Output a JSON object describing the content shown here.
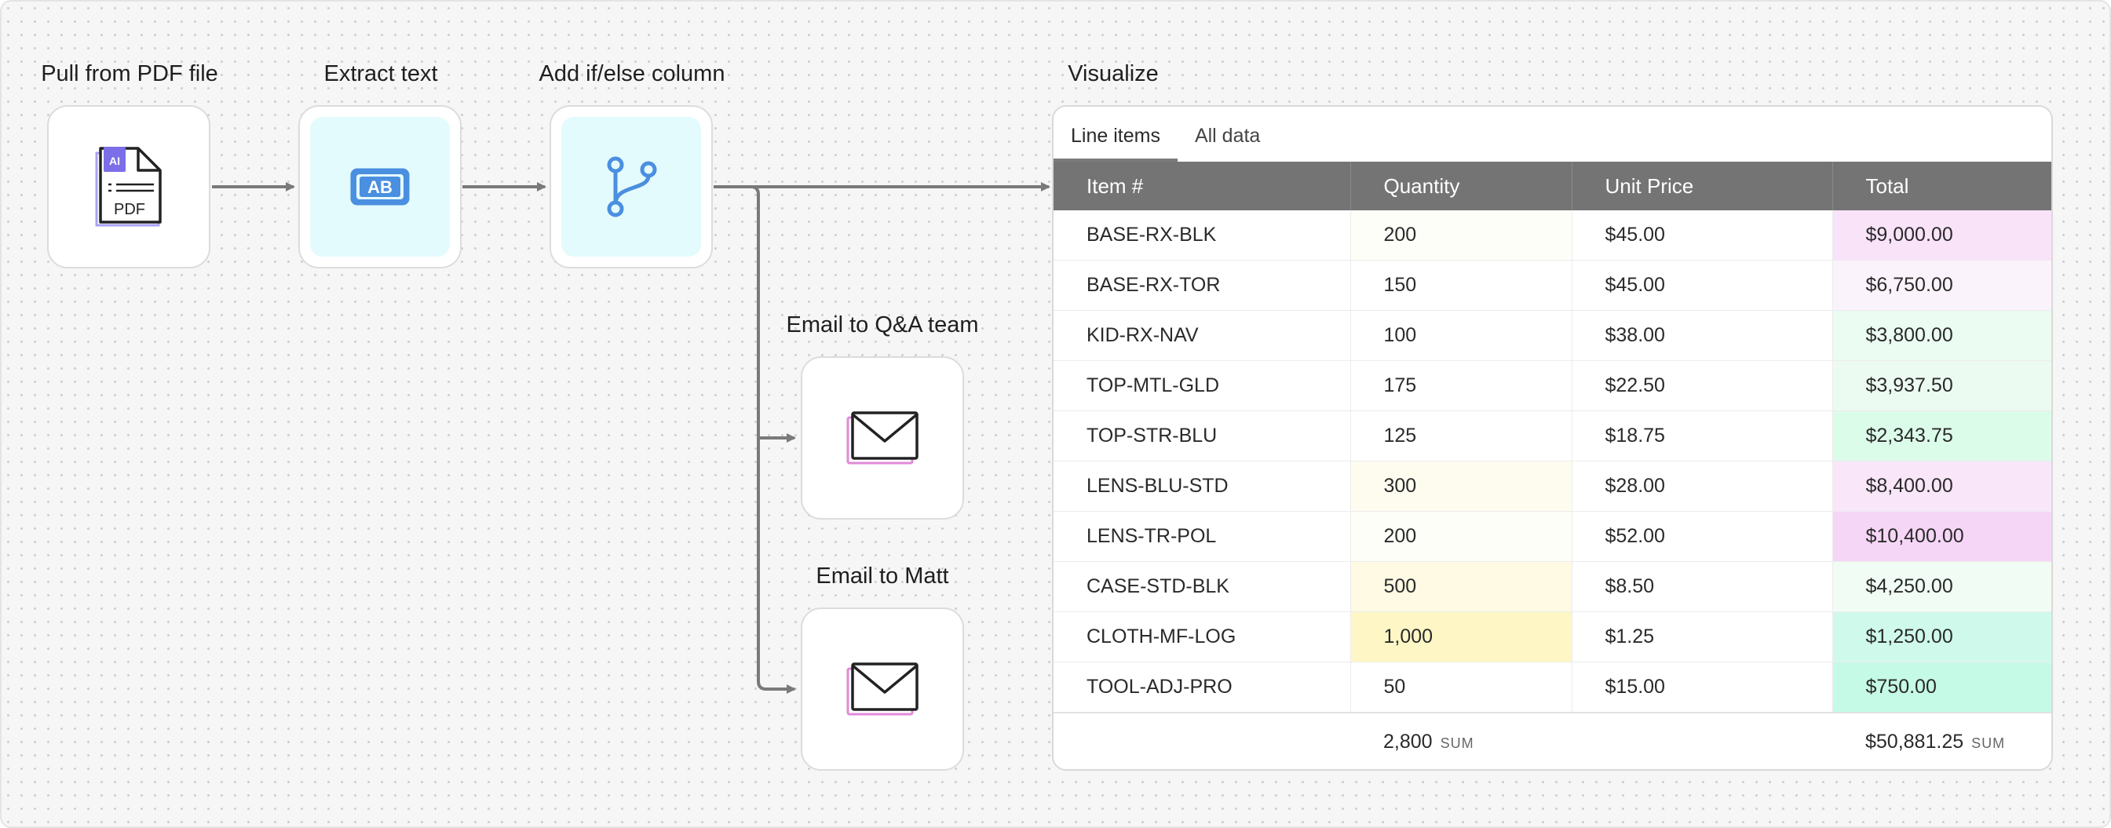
{
  "nodes": {
    "pdf": {
      "label": "Pull from PDF file",
      "badge": "AI",
      "file_text": "PDF",
      "icon": "pdf-file-icon"
    },
    "extract": {
      "label": "Extract text",
      "icon_text": "AB",
      "icon": "text-extract-icon"
    },
    "branch": {
      "label": "Add if/else column",
      "icon": "branch-icon"
    },
    "email_qa": {
      "label": "Email to Q&A team",
      "icon": "envelope-icon"
    },
    "email_matt": {
      "label": "Email to Matt",
      "icon": "envelope-icon"
    },
    "visualize": {
      "label": "Visualize"
    }
  },
  "tabs": [
    {
      "label": "Line items",
      "active": true
    },
    {
      "label": "All data",
      "active": false
    }
  ],
  "table": {
    "columns": [
      "Item #",
      "Quantity",
      "Unit Price",
      "Total"
    ],
    "rows": [
      [
        "BASE-RX-BLK",
        "200",
        "$45.00",
        "$9,000.00"
      ],
      [
        "BASE-RX-TOR",
        "150",
        "$45.00",
        "$6,750.00"
      ],
      [
        "KID-RX-NAV",
        "100",
        "$38.00",
        "$3,800.00"
      ],
      [
        "TOP-MTL-GLD",
        "175",
        "$22.50",
        "$3,937.50"
      ],
      [
        "TOP-STR-BLU",
        "125",
        "$18.75",
        "$2,343.75"
      ],
      [
        "LENS-BLU-STD",
        "300",
        "$28.00",
        "$8,400.00"
      ],
      [
        "LENS-TR-POL",
        "200",
        "$52.00",
        "$10,400.00"
      ],
      [
        "CASE-STD-BLK",
        "500",
        "$8.50",
        "$4,250.00"
      ],
      [
        "CLOTH-MF-LOG",
        "1,000",
        "$1.25",
        "$1,250.00"
      ],
      [
        "TOOL-ADJ-PRO",
        "50",
        "$15.00",
        "$750.00"
      ]
    ],
    "quantity_colors": [
      "#fefef8",
      "#ffffff",
      "#ffffff",
      "#ffffff",
      "#ffffff",
      "#fefcef",
      "#fefef8",
      "#fefae3",
      "#fef7c5",
      "#ffffff"
    ],
    "total_colors": [
      "#f9e3f9",
      "#fbf3fb",
      "#ebfcf2",
      "#ecfbf2",
      "#dcfcea",
      "#f9e6f9",
      "#f6d6f6",
      "#f1fcf5",
      "#cffaeb",
      "#c5fae6"
    ],
    "footer": {
      "quantity_sum": "2,800",
      "quantity_tag": "SUM",
      "total_sum": "$50,881.25",
      "total_tag": "SUM"
    }
  }
}
